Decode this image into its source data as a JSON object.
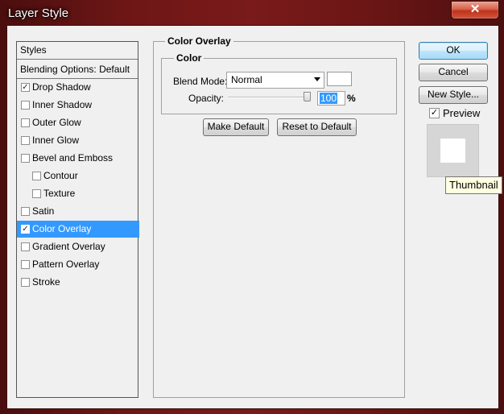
{
  "window": {
    "title": "Layer Style",
    "close_glyph": "✕"
  },
  "styles_panel": {
    "header": "Styles",
    "blending_options": "Blending Options: Default",
    "items": [
      {
        "label": "Drop Shadow",
        "checked": true,
        "selected": false,
        "indent": false
      },
      {
        "label": "Inner Shadow",
        "checked": false,
        "selected": false,
        "indent": false
      },
      {
        "label": "Outer Glow",
        "checked": false,
        "selected": false,
        "indent": false
      },
      {
        "label": "Inner Glow",
        "checked": false,
        "selected": false,
        "indent": false
      },
      {
        "label": "Bevel and Emboss",
        "checked": false,
        "selected": false,
        "indent": false
      },
      {
        "label": "Contour",
        "checked": false,
        "selected": false,
        "indent": true
      },
      {
        "label": "Texture",
        "checked": false,
        "selected": false,
        "indent": true
      },
      {
        "label": "Satin",
        "checked": false,
        "selected": false,
        "indent": false
      },
      {
        "label": "Color Overlay",
        "checked": true,
        "selected": true,
        "indent": false
      },
      {
        "label": "Gradient Overlay",
        "checked": false,
        "selected": false,
        "indent": false
      },
      {
        "label": "Pattern Overlay",
        "checked": false,
        "selected": false,
        "indent": false
      },
      {
        "label": "Stroke",
        "checked": false,
        "selected": false,
        "indent": false
      }
    ]
  },
  "color_overlay": {
    "section_title": "Color Overlay",
    "group_title": "Color",
    "blend_mode_label": "Blend Mode:",
    "blend_mode_value": "Normal",
    "overlay_color": "#ffffff",
    "opacity_label": "Opacity:",
    "opacity_value": "100",
    "opacity_unit": "%",
    "opacity_fraction": 1.0,
    "make_default": "Make Default",
    "reset_default": "Reset to Default"
  },
  "actions": {
    "ok": "OK",
    "cancel": "Cancel",
    "new_style": "New Style...",
    "preview_label": "Preview",
    "preview_checked": true
  },
  "tooltip": {
    "text": "Thumbnail"
  },
  "colors": {
    "selection": "#3399ff",
    "dialog_bg": "#f0f0f0",
    "frame": "#6e1616"
  },
  "icons": {
    "checkmark": "✓"
  }
}
